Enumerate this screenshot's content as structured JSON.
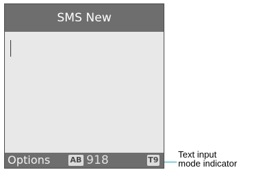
{
  "screen": {
    "title": "SMS New",
    "softkeys": {
      "left_label": "Options",
      "input_mode_badge": "AB",
      "char_counter": "918",
      "t9_badge": "T9"
    }
  },
  "annotation": {
    "line1": "Text input",
    "line2": "mode indicator"
  },
  "colors": {
    "bar_bg": "#6e6e6e",
    "screen_bg": "#e8e8e8",
    "callout_line": "#1ea7b8"
  }
}
